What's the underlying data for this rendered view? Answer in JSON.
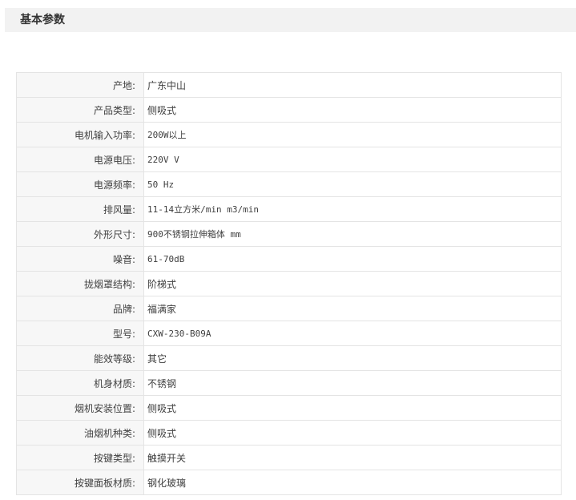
{
  "header": {
    "title": "基本参数"
  },
  "params": [
    {
      "label": "产地:",
      "value": "广东中山"
    },
    {
      "label": "产品类型:",
      "value": "侧吸式"
    },
    {
      "label": "电机输入功率:",
      "value": "200W以上"
    },
    {
      "label": "电源电压:",
      "value": "220V V"
    },
    {
      "label": "电源频率:",
      "value": "50 Hz"
    },
    {
      "label": "排风量:",
      "value": "11-14立方米/min m3/min"
    },
    {
      "label": "外形尺寸:",
      "value": "900不锈钢拉伸箱体 mm"
    },
    {
      "label": "噪音:",
      "value": "61-70dB"
    },
    {
      "label": "拢烟罩结构:",
      "value": "阶梯式"
    },
    {
      "label": "品牌:",
      "value": "福满家"
    },
    {
      "label": "型号:",
      "value": "CXW-230-B09A"
    },
    {
      "label": "能效等级:",
      "value": "其它"
    },
    {
      "label": "机身材质:",
      "value": "不锈钢"
    },
    {
      "label": "烟机安装位置:",
      "value": "侧吸式"
    },
    {
      "label": "油烟机种类:",
      "value": "侧吸式"
    },
    {
      "label": "按键类型:",
      "value": "触摸开关"
    },
    {
      "label": "按键面板材质:",
      "value": "钢化玻璃"
    }
  ]
}
